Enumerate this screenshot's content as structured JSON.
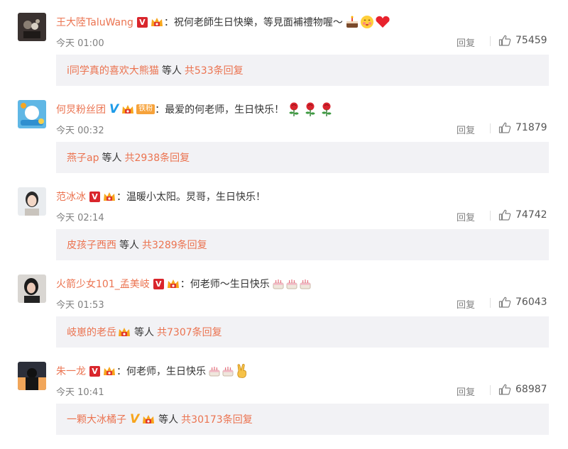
{
  "comments": [
    {
      "username": "王大陸TaluWang",
      "badges": [
        "red-v-badge",
        "crown-icon"
      ],
      "colon": "：",
      "text": "祝何老師生日快樂，等見面補禮物喔～",
      "emojis": [
        "cake-emoji",
        "blush-emoji",
        "red-heart-emoji"
      ],
      "time": "今天 01:00",
      "reply_label": "回复",
      "likes": "75459",
      "reply_box": {
        "name": "i同学真的喜欢大熊猫",
        "mid": "等人",
        "total": "共533条回复"
      }
    },
    {
      "username": "何炅粉丝团",
      "badges": [
        "blue-v-badge",
        "crown-icon",
        "fan-badge"
      ],
      "fan_badge_text": "铁粉",
      "colon": "：",
      "text": "最爱的何老师，生日快乐！",
      "emojis": [
        "rose-emoji",
        "rose-emoji",
        "rose-emoji"
      ],
      "time": "今天 00:32",
      "reply_label": "回复",
      "likes": "71879",
      "reply_box": {
        "name": "燕子ap",
        "mid": "等人",
        "total": "共2938条回复"
      }
    },
    {
      "username": "范冰冰",
      "badges": [
        "red-v-badge",
        "crown-icon"
      ],
      "colon": "：",
      "text": "温暖小太阳。炅哥，生日快乐！",
      "emojis": [],
      "time": "今天 02:14",
      "reply_label": "回复",
      "likes": "74742",
      "reply_box": {
        "name": "皮孩子西西",
        "mid": "等人",
        "total": "共3289条回复"
      }
    },
    {
      "username": "火箭少女101_孟美岐",
      "badges": [
        "red-v-badge",
        "crown-icon"
      ],
      "colon": "：",
      "text": "何老师～生日快乐",
      "emojis": [
        "small-cake-emoji",
        "small-cake-emoji",
        "small-cake-emoji"
      ],
      "time": "今天 01:53",
      "reply_label": "回复",
      "likes": "76043",
      "reply_box": {
        "name": "岐崽的老岳",
        "mid": "等人",
        "total": "共7307条回复"
      }
    },
    {
      "username": "朱一龙",
      "badges": [
        "red-v-badge",
        "crown-icon"
      ],
      "colon": "：",
      "text": "何老师，生日快乐",
      "emojis": [
        "small-cake-emoji",
        "small-cake-emoji",
        "victory-hand-emoji"
      ],
      "time": "今天 10:41",
      "reply_label": "回复",
      "likes": "68987",
      "reply_box": {
        "name": "一颗大冰橘子",
        "mid": "等人",
        "total": "共30173条回复"
      }
    }
  ],
  "badge_letter": "V",
  "colors": {
    "username": "#eb7350",
    "red_v": "#d9262c",
    "blue_v": "#1e9be8",
    "gold_v": "#f7a51c",
    "reply_box_bg": "#f2f2f5",
    "meta_gray": "#808080"
  }
}
